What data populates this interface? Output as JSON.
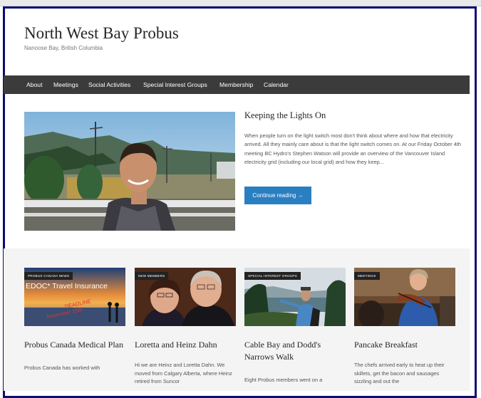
{
  "site": {
    "title": "North West Bay Probus",
    "tagline": "Nanoose Bay, British Columbia"
  },
  "nav": {
    "items": [
      {
        "label": "About"
      },
      {
        "label": "Meetings"
      },
      {
        "label": "Social Activities"
      },
      {
        "label": "Special Interest Groups"
      },
      {
        "label": "Membership"
      },
      {
        "label": "Calendar"
      }
    ]
  },
  "featured": {
    "title": "Keeping the Lights On",
    "excerpt": "When people turn on the light switch most don't think about where and how that electricity arrived. All they mainly care about is that the light switch comes on. At our Friday October 4th meeting BC Hydro's Stephen Watson will provide an overview of the Vancouver Island electricity grid (including our local grid) and how they keep...",
    "button_label": "Continue reading →"
  },
  "cards": [
    {
      "badge": "PROBUS CANADA NEWS",
      "title": "Probus Canada Medical Plan",
      "excerpt": "Probus Canada has worked with",
      "image_text": {
        "line1": "EDOC* Travel Insurance",
        "line2": "DEADLINE",
        "line3": "November 15th"
      }
    },
    {
      "badge": "NEW MEMBERS",
      "title": "Loretta and Heinz Dahn",
      "excerpt": "Hi we are Heinz and Loretta Dahn. We moved from Calgary Alberta, where Heinz retired from Suncor"
    },
    {
      "badge": "SPECIAL INTEREST GROUPS",
      "title": "Cable Bay and Dodd's Narrows Walk",
      "excerpt": "Eight Probus members went on a"
    },
    {
      "badge": "MEETINGS",
      "title": "Pancake Breakfast",
      "excerpt": "The chefs arrived early to heat up their skillets, get the bacon and sausages sizzling and out the"
    }
  ],
  "colors": {
    "frame": "#0b0d70",
    "nav_background": "#3b3b3b",
    "button": "#2a7fc1"
  }
}
